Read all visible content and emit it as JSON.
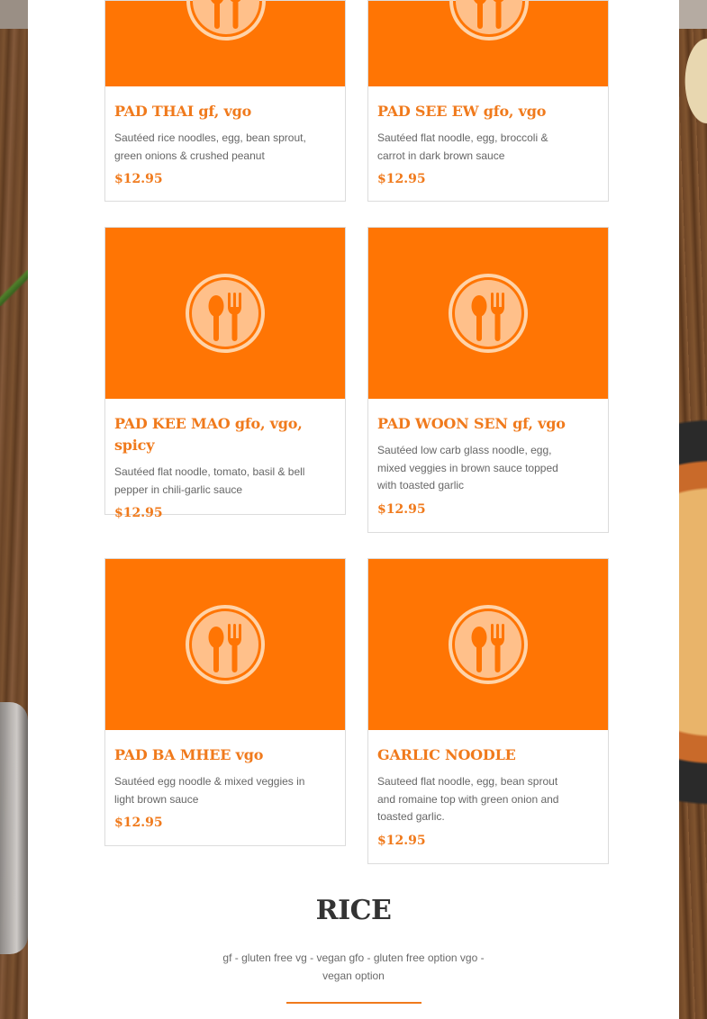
{
  "colors": {
    "accent": "#f07a1c",
    "photo_placeholder": "#ff7504",
    "title_dark": "#333333",
    "body_text": "#666666"
  },
  "menu_items": [
    {
      "name": "PAD THAI gf, vgo",
      "description": "Sautéed rice noodles, egg, bean sprout, green onions & crushed peanut",
      "price": "$12.95",
      "icon": "spoon-fork-icon"
    },
    {
      "name": "PAD SEE EW gfo, vgo",
      "description": "Sautéed flat noodle, egg, broccoli & carrot in dark brown sauce",
      "price": "$12.95",
      "icon": "spoon-fork-icon"
    },
    {
      "name": "PAD KEE MAO gfo, vgo, spicy",
      "description": "Sautéed flat noodle, tomato, basil & bell pepper in chili-garlic sauce",
      "price": "$12.95",
      "icon": "spoon-fork-icon"
    },
    {
      "name": "PAD WOON SEN gf, vgo",
      "description": "Sautéed low carb glass noodle, egg, mixed veggies in brown sauce topped with toasted garlic",
      "price": "$12.95",
      "icon": "spoon-fork-icon"
    },
    {
      "name": "PAD BA MHEE vgo",
      "description": "Sautéed egg noodle & mixed veggies in light brown sauce",
      "price": "$12.95",
      "icon": "spoon-fork-icon"
    },
    {
      "name": "GARLIC NOODLE",
      "description": "Sauteed flat noodle, egg, bean sprout and romaine top with green onion and toasted garlic.",
      "price": "$12.95",
      "icon": "spoon-fork-icon"
    }
  ],
  "next_section": {
    "title": "RICE",
    "legend": "gf - gluten free vg - vegan gfo - gluten free option vgo - vegan option"
  }
}
